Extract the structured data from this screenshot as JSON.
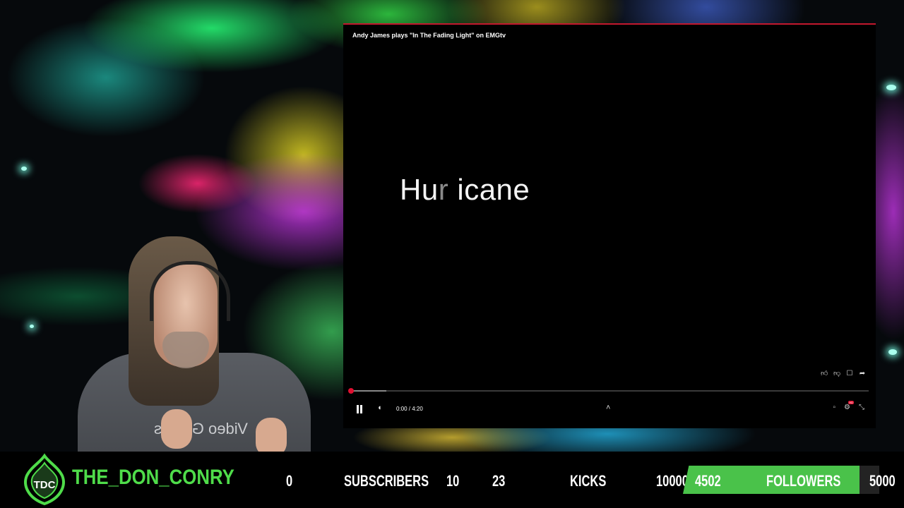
{
  "player": {
    "title": "Andy James plays \"In The Fading Light\" on EMGtv",
    "lyric_lit": "Hu",
    "lyric_dim": "r",
    "lyric_rest": " icane",
    "time": "0:00 / 4:20",
    "progress_fraction": 0.0,
    "buffer_fraction": 0.07,
    "hd_badge": "HD",
    "icons": [
      "like-icon",
      "dislike-icon",
      "comment-icon",
      "share-icon",
      "pause-icon",
      "volume-icon",
      "chevron-up-icon",
      "settings-icon",
      "fullscreen-exit-icon"
    ]
  },
  "webcam": {
    "shirt_text": "Video Games"
  },
  "footer": {
    "logo_text": "TDC",
    "channel": "THE_DON_CONRY",
    "subscribers_current": "0",
    "subscribers_label": "SUBSCRIBERS",
    "subscribers_goal": "10",
    "kicks_current": "23",
    "kicks_label": "KICKS",
    "kicks_goal": "10000",
    "followers_current": "4502",
    "followers_label": "FOLLOWERS",
    "followers_goal": "5000",
    "followers_fraction": 0.9004,
    "accent_color": "#4ac24a"
  }
}
